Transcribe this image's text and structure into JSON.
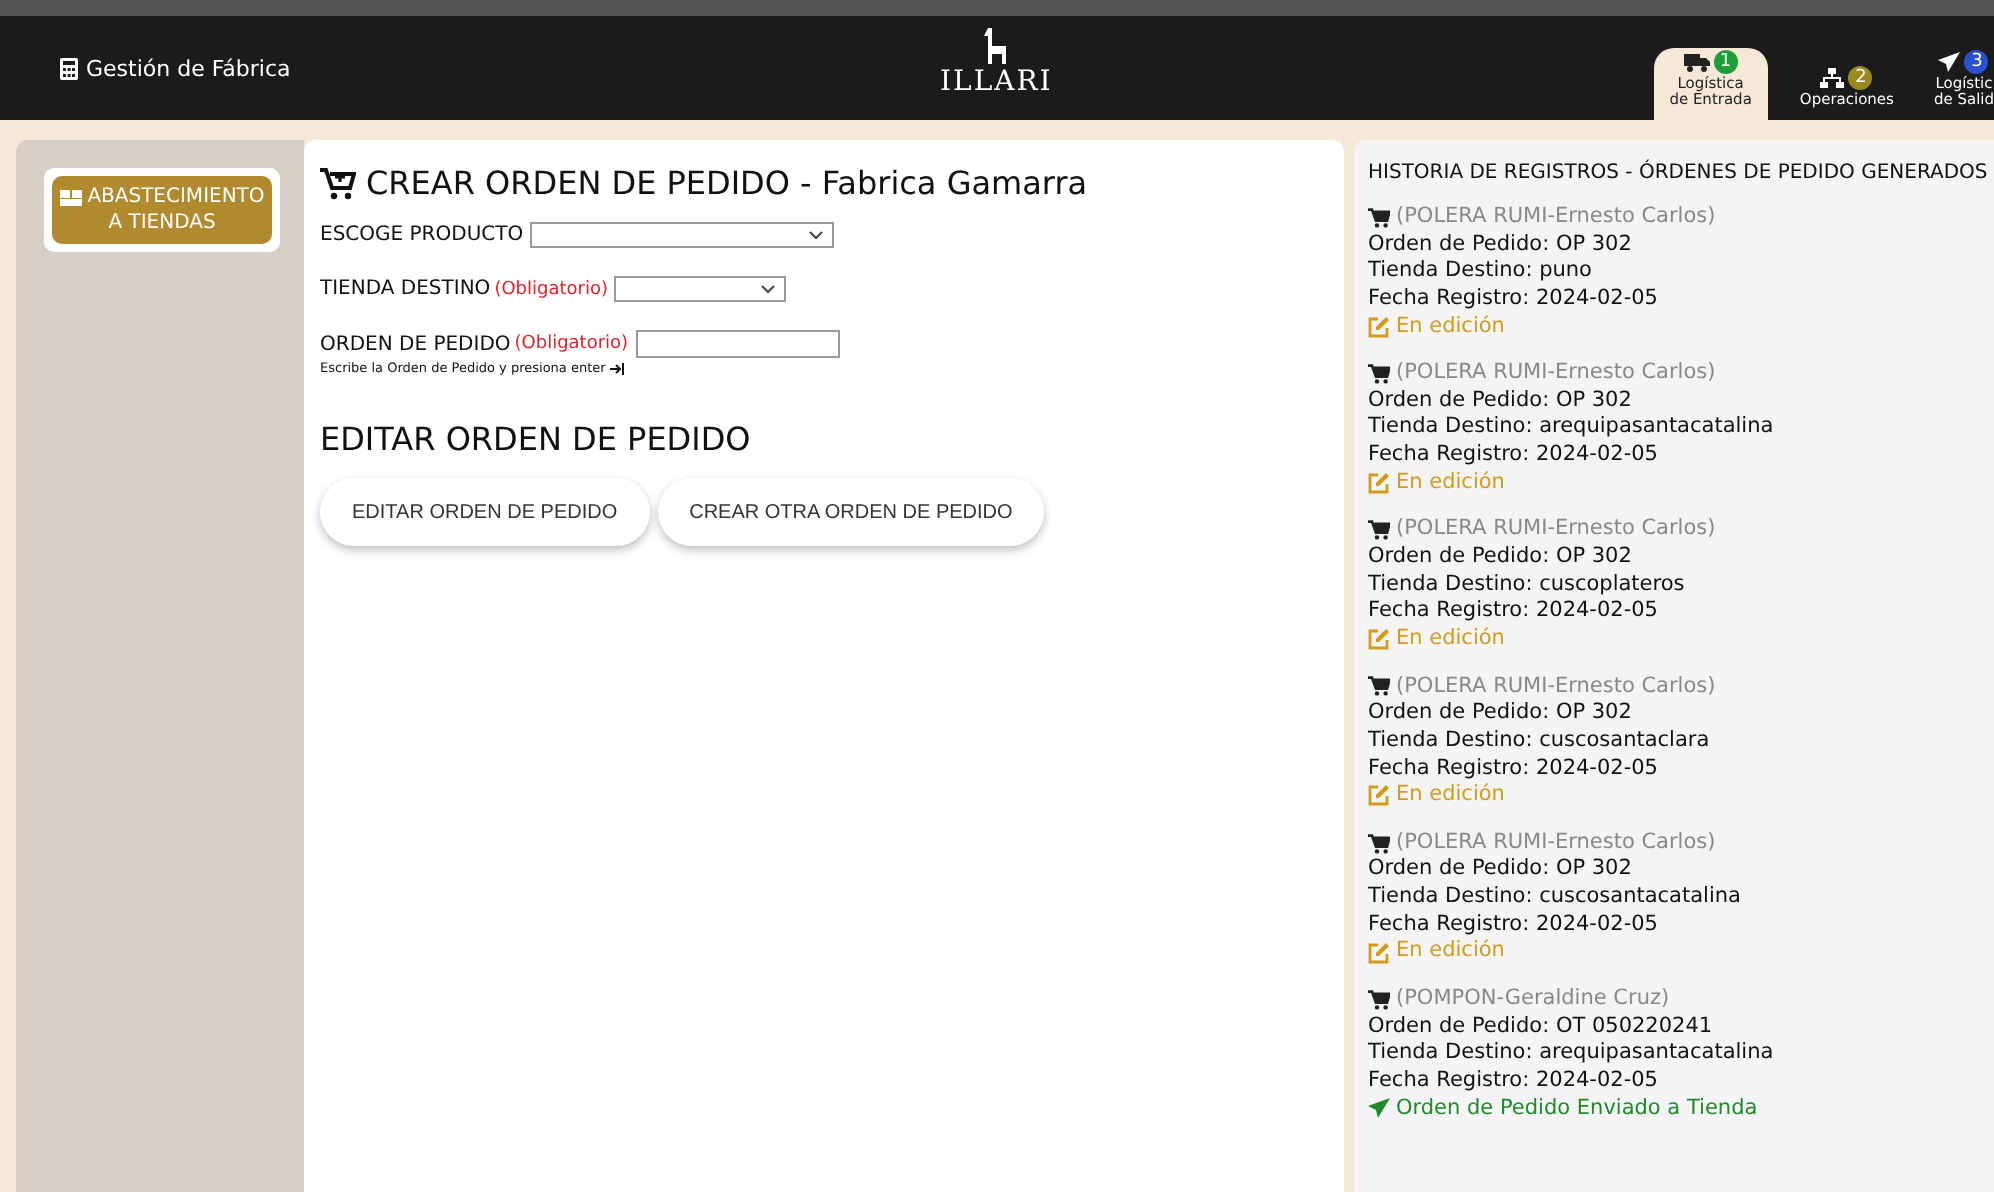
{
  "navbar": {
    "app_title": "Gestión de Fábrica",
    "logo": "ILLARI",
    "tabs": [
      {
        "label": [
          "Logística",
          "de Entrada"
        ],
        "badge": "1",
        "color": "#1e9e3a",
        "selected": true
      },
      {
        "label": [
          "Operaciones"
        ],
        "badge": "2",
        "color": "#9a8a1e",
        "selected": false
      },
      {
        "label": [
          "Logístic",
          "de Salid"
        ],
        "badge": "3",
        "color": "#2a4fd0",
        "selected": false
      }
    ]
  },
  "sidebar": {
    "items": [
      {
        "label": [
          "ABASTECIMIENTO",
          "A TIENDAS"
        ],
        "selected": true
      }
    ]
  },
  "form": {
    "title": "CREAR ORDEN DE PEDIDO - Fabrica Gamarra",
    "fields": [
      {
        "kind": "select",
        "label": "ESCOGE PRODUCTO"
      },
      {
        "kind": "select",
        "label": "TIENDA DESTINO",
        "required": "(Obligatorio)"
      },
      {
        "kind": "input",
        "label": "ORDEN DE PEDIDO",
        "required": "(Obligatorio)",
        "hint": "Escribe la Orden de Pedido y presiona enter"
      }
    ],
    "edit_title": "EDITAR ORDEN DE PEDIDO",
    "buttons": [
      "EDITAR ORDEN DE PEDIDO",
      "CREAR OTRA ORDEN DE PEDIDO"
    ]
  },
  "history": {
    "title": "HISTORIA DE REGISTROS - ÓRDENES DE PEDIDO GENERADOS",
    "records": [
      {
        "product": "(POLERA RUMI-Ernesto Carlos)",
        "order": "Orden de Pedido: OP 302",
        "store": "Tienda Destino: puno",
        "date": "Fecha Registro: 2024-02-05",
        "status": "En edición",
        "kind": "editing"
      },
      {
        "product": "(POLERA RUMI-Ernesto Carlos)",
        "order": "Orden de Pedido: OP 302",
        "store": "Tienda Destino: arequipasantacatalina",
        "date": "Fecha Registro: 2024-02-05",
        "status": "En edición",
        "kind": "editing"
      },
      {
        "product": "(POLERA RUMI-Ernesto Carlos)",
        "order": "Orden de Pedido: OP 302",
        "store": "Tienda Destino: cuscoplateros",
        "date": "Fecha Registro: 2024-02-05",
        "status": "En edición",
        "kind": "editing"
      },
      {
        "product": "(POLERA RUMI-Ernesto Carlos)",
        "order": "Orden de Pedido: OP 302",
        "store": "Tienda Destino: cuscosantaclara",
        "date": "Fecha Registro: 2024-02-05",
        "status": "En edición",
        "kind": "editing"
      },
      {
        "product": "(POLERA RUMI-Ernesto Carlos)",
        "order": "Orden de Pedido: OP 302",
        "store": "Tienda Destino: cuscosantacatalina",
        "date": "Fecha Registro: 2024-02-05",
        "status": "En edición",
        "kind": "editing"
      },
      {
        "product": "(POMPON-Geraldine Cruz)",
        "order": "Orden de Pedido: OT 050220241",
        "store": "Tienda Destino: arequipasantacatalina",
        "date": "Fecha Registro: 2024-02-05",
        "status": "Orden de Pedido Enviado a Tienda",
        "kind": "sent"
      }
    ]
  }
}
